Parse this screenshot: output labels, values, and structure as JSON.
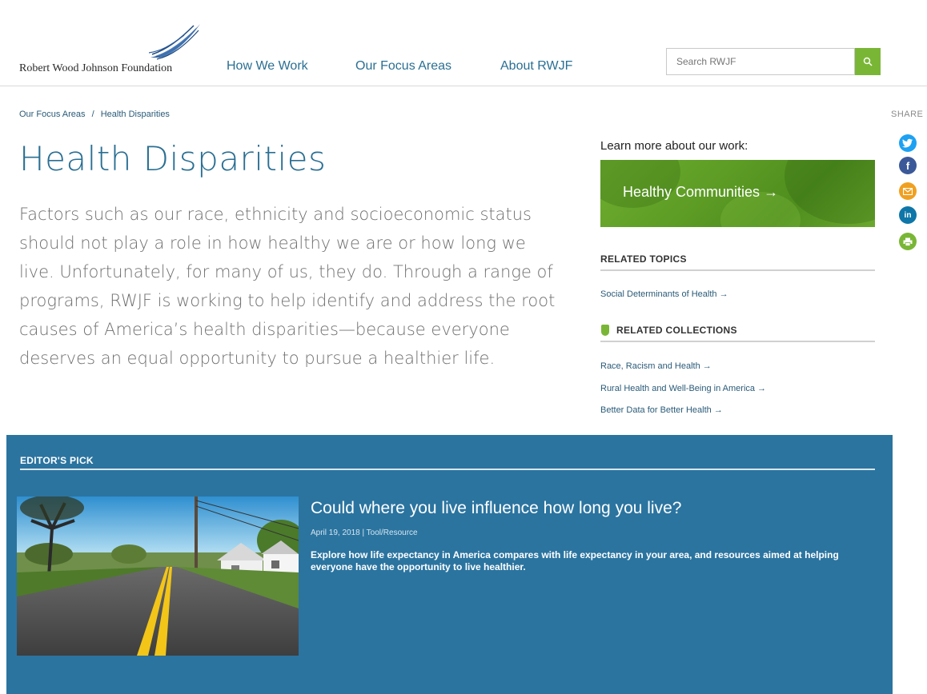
{
  "header": {
    "logo_text": "Robert Wood Johnson Foundation",
    "nav": [
      "How We Work",
      "Our Focus Areas",
      "About RWJF"
    ],
    "search_placeholder": "Search RWJF"
  },
  "breadcrumb": {
    "parent": "Our Focus Areas",
    "separator": "/",
    "current": "Health Disparities"
  },
  "share": {
    "label": "SHARE",
    "icons": [
      "twitter-icon",
      "facebook-icon",
      "email-icon",
      "linkedin-icon",
      "print-icon"
    ]
  },
  "main": {
    "title": "Health Disparities",
    "intro": "Factors such as our race, ethnicity and socioeconomic status should not play a role in how healthy we are or how long we live. Unfortunately, for many of us, they do. Through a range of programs, RWJF is working to help identify and address the root causes of America’s health disparities—because everyone deserves an equal opportunity to pursue a healthier life."
  },
  "sidebar": {
    "learn_label": "Learn more about our work:",
    "promo": "Healthy Communities →",
    "related_topics_head": "RELATED TOPICS",
    "related_topics": [
      "Social Determinants of Health →"
    ],
    "related_collections_head": "RELATED COLLECTIONS",
    "related_collections": [
      "Race, Racism and Health →",
      "Rural Health and Well-Being in America →",
      "Better Data for Better Health →"
    ]
  },
  "editors_pick": {
    "label": "EDITOR'S PICK",
    "title": "Could where you live influence how long you live?",
    "meta": "April 19, 2018 | Tool/Resource",
    "description": "Explore how life expectancy in America compares with life expectancy in your area, and resources aimed at helping everyone have the opportunity to live healthier."
  },
  "colors": {
    "brand_blue": "#2a6f93",
    "accent_green": "#7ab636",
    "editors_pick_bg": "#2b74a0"
  }
}
